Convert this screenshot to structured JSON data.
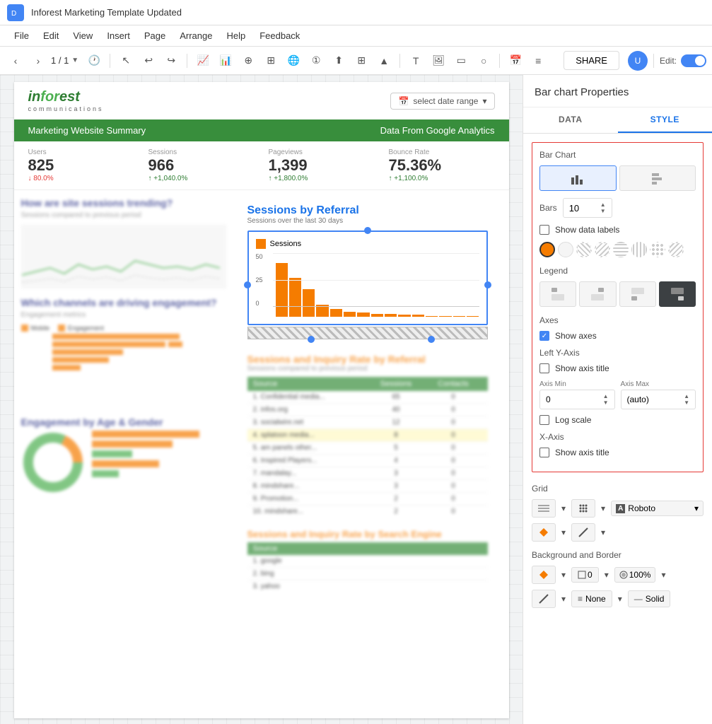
{
  "app": {
    "title": "Inforest  Marketing Template Updated",
    "icon_color": "#4285f4"
  },
  "menu": {
    "items": [
      "File",
      "Edit",
      "View",
      "Insert",
      "Page",
      "Arrange",
      "Help",
      "Feedback"
    ]
  },
  "toolbar": {
    "page_current": "1",
    "page_total": "1",
    "share_label": "SHARE",
    "edit_label": "Edit:"
  },
  "page": {
    "logo_text": "inforest",
    "logo_sub": "communications",
    "date_range_label": "select date range",
    "header_left": "Marketing Website Summary",
    "header_right": "Data From Google Analytics",
    "metrics": [
      {
        "label": "Users",
        "value": "825",
        "change": "↓ 80.0%"
      },
      {
        "label": "Sessions",
        "value": "966",
        "change": "↑ +1,040.0%"
      },
      {
        "label": "Pageviews",
        "value": "1,399",
        "change": "↑ +1,800.0%"
      },
      {
        "label": "Bounce Rate",
        "value": "75.36%",
        "change": "↑ +1,100.0%"
      }
    ],
    "sessions_by_referral": {
      "title": "Sessions by Referral",
      "subtitle": "Sessions over the last 30 days",
      "legend": "Sessions",
      "y_labels": [
        "50",
        "25",
        "0"
      ],
      "bars": [
        55,
        40,
        28,
        12,
        8,
        5,
        4,
        3,
        3,
        2,
        2,
        1,
        1,
        1,
        1
      ]
    }
  },
  "side_panel": {
    "title": "Bar chart Properties",
    "tabs": [
      "DATA",
      "STYLE"
    ],
    "active_tab": "STYLE",
    "style": {
      "bar_chart_label": "Bar Chart",
      "chart_type_buttons": [
        "bar-vertical",
        "bar-horizontal"
      ],
      "bars_label": "Bars",
      "bars_value": "10",
      "show_data_labels": "Show data labels",
      "legend_label": "Legend",
      "legend_options": [
        "top-left",
        "top-right",
        "bottom-left",
        "bottom-right"
      ],
      "axes_label": "Axes",
      "show_axes": "Show axes",
      "show_axes_checked": true,
      "left_y_axis_label": "Left Y-Axis",
      "show_axis_title_y": "Show axis title",
      "axis_min_label": "Axis Min",
      "axis_min_value": "0",
      "axis_max_label": "Axis Max",
      "axis_max_value": "(auto)",
      "log_scale": "Log scale",
      "x_axis_label": "X-Axis",
      "show_axis_title_x": "Show axis title",
      "grid_label": "Grid",
      "font_label": "Roboto",
      "bg_border_label": "Background and Border",
      "opacity_value": "100%",
      "border_value": "0",
      "border_style_value": "None",
      "border_line_value": "Solid"
    }
  }
}
